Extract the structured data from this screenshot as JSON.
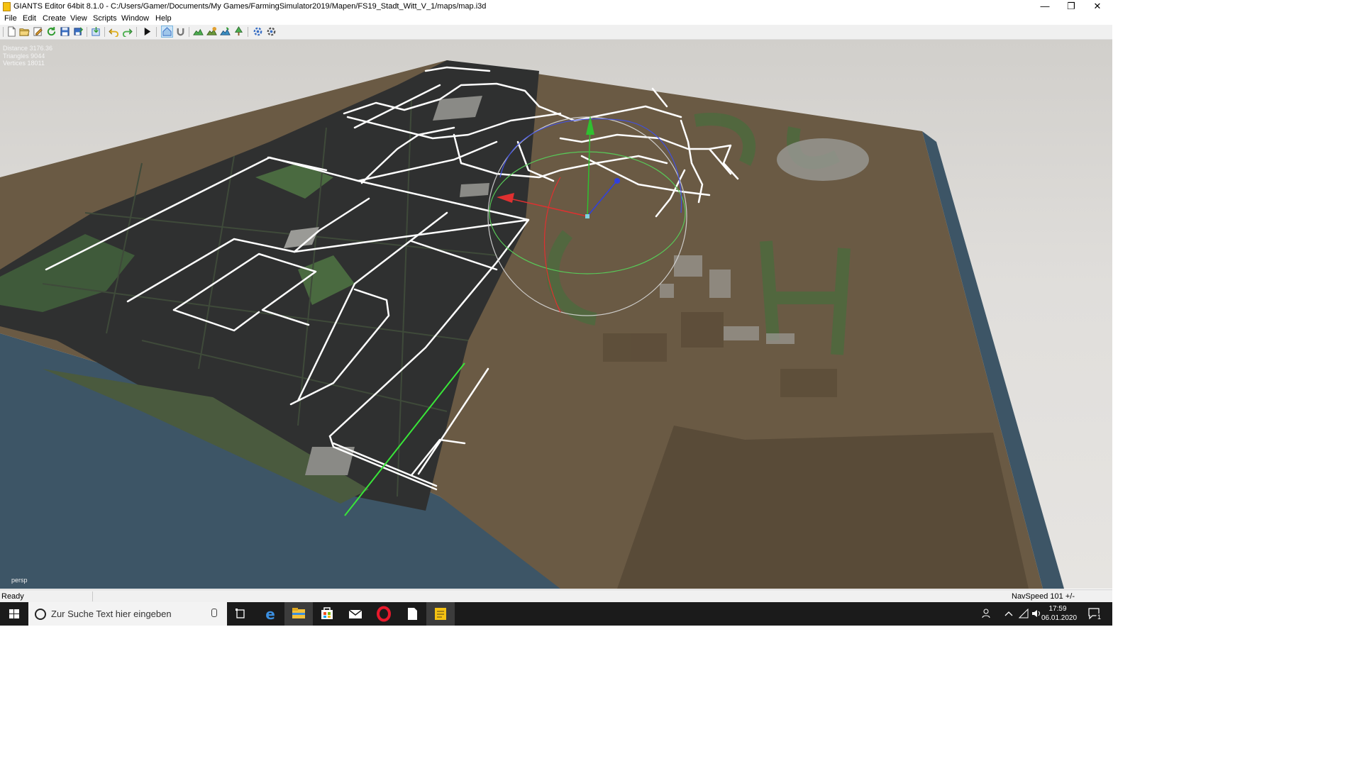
{
  "window": {
    "title": "GIANTS Editor 64bit 8.1.0 - C:/Users/Gamer/Documents/My Games/FarmingSimulator2019/Mapen/FS19_Stadt_Witt_V_1/maps/map.i3d",
    "controls": {
      "minimize": "—",
      "restore": "❐",
      "close": "✕"
    }
  },
  "menu": [
    "File",
    "Edit",
    "Create",
    "View",
    "Scripts",
    "Window",
    "Help"
  ],
  "toolbar": {
    "icons": [
      "new-file-icon",
      "open-file-icon",
      "edit-icon",
      "refresh-icon",
      "save-icon",
      "save-as-icon",
      "import-icon",
      "undo-icon",
      "redo-icon",
      "play-icon",
      "home-view-icon",
      "magnet-icon",
      "terrain-icon",
      "paint-icon",
      "foliage-icon",
      "tree-icon",
      "settings-icon",
      "network-icon"
    ]
  },
  "viewport": {
    "stats": [
      "Distance 3176.36",
      "Triangles 9044",
      "Vertices 18011"
    ],
    "camera_label": "persp"
  },
  "statusbar": {
    "status": "Ready",
    "navspeed": "NavSpeed 101 +/-"
  },
  "taskbar": {
    "search_placeholder": "Zur Suche Text hier eingeben",
    "apps": [
      "task-view-icon",
      "edge-icon",
      "file-explorer-icon",
      "store-icon",
      "mail-icon",
      "opera-icon",
      "notepad-icon",
      "giants-editor-icon"
    ],
    "time": "17:59",
    "date": "06.01.2020",
    "notification_count": "1"
  },
  "colors": {
    "accent_taskbar": "#76b9ed",
    "terrain_brown": "#6a5a44",
    "field_dark": "#2f3030",
    "spline_white": "#ffffff",
    "spline_selected": "#39e639",
    "gizmo_x": "#e03030",
    "gizmo_y": "#30c030",
    "gizmo_z": "#3040e0"
  }
}
